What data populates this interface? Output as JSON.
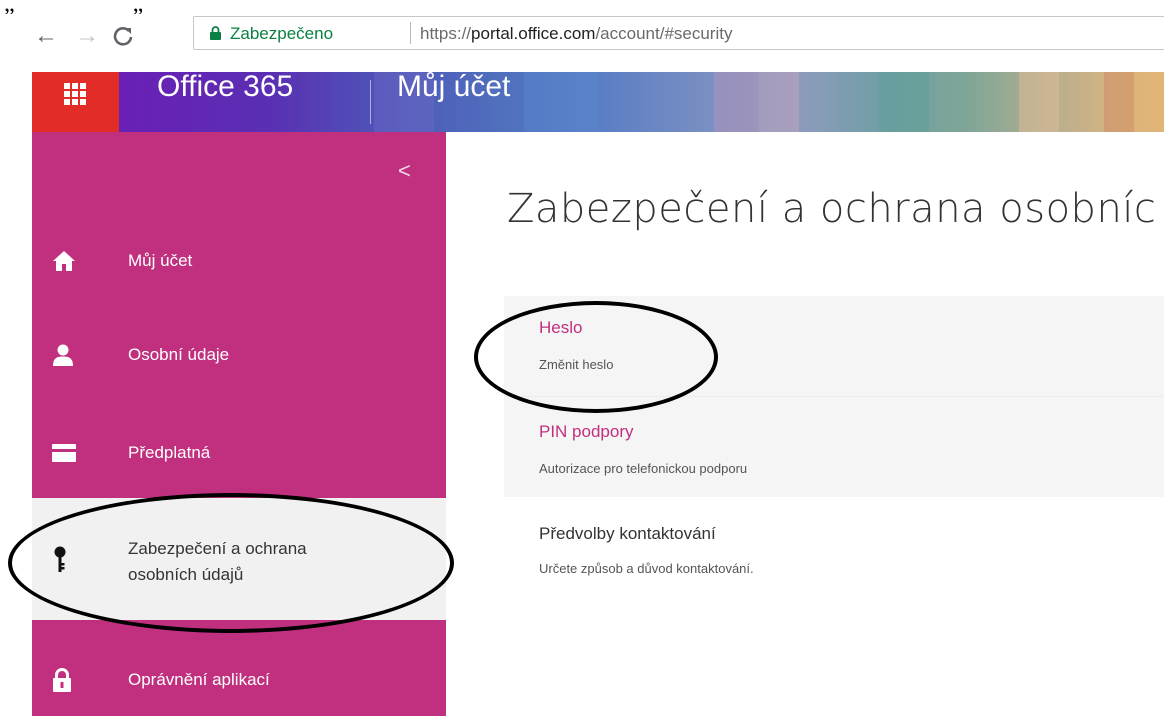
{
  "top_marks": "„ „",
  "browser": {
    "secure_label": "Zabezpečeno",
    "url_scheme": "https://",
    "url_host": "portal.office.com",
    "url_path": "/account/#security",
    "secure_color": "#0b8043"
  },
  "header": {
    "product": "Office 365",
    "page": "Můj účet",
    "waffle_color": "#e22c27"
  },
  "nav": {
    "accent_color": "#c1307f",
    "collapse_glyph": "<",
    "items": [
      {
        "label": "Můj účet",
        "icon": "home-icon"
      },
      {
        "label": "Osobní údaje",
        "icon": "person-icon"
      },
      {
        "label": "Předplatná",
        "icon": "credit-card-icon"
      },
      {
        "label_line1": "Zabezpečení a ochrana",
        "label_line2": "osobních údajů",
        "icon": "key-icon",
        "selected": true
      },
      {
        "label": "Oprávnění aplikací",
        "icon": "lock-icon"
      }
    ]
  },
  "main": {
    "title": "Zabezpečení a ochrana osobníc",
    "rows": [
      {
        "title": "Heslo",
        "subtitle": "Změnit heslo"
      },
      {
        "title": "PIN podpory",
        "subtitle": "Autorizace pro telefonickou podporu"
      },
      {
        "title": "Předvolby kontaktování",
        "subtitle": "Určete způsob a důvod kontaktování."
      }
    ]
  }
}
